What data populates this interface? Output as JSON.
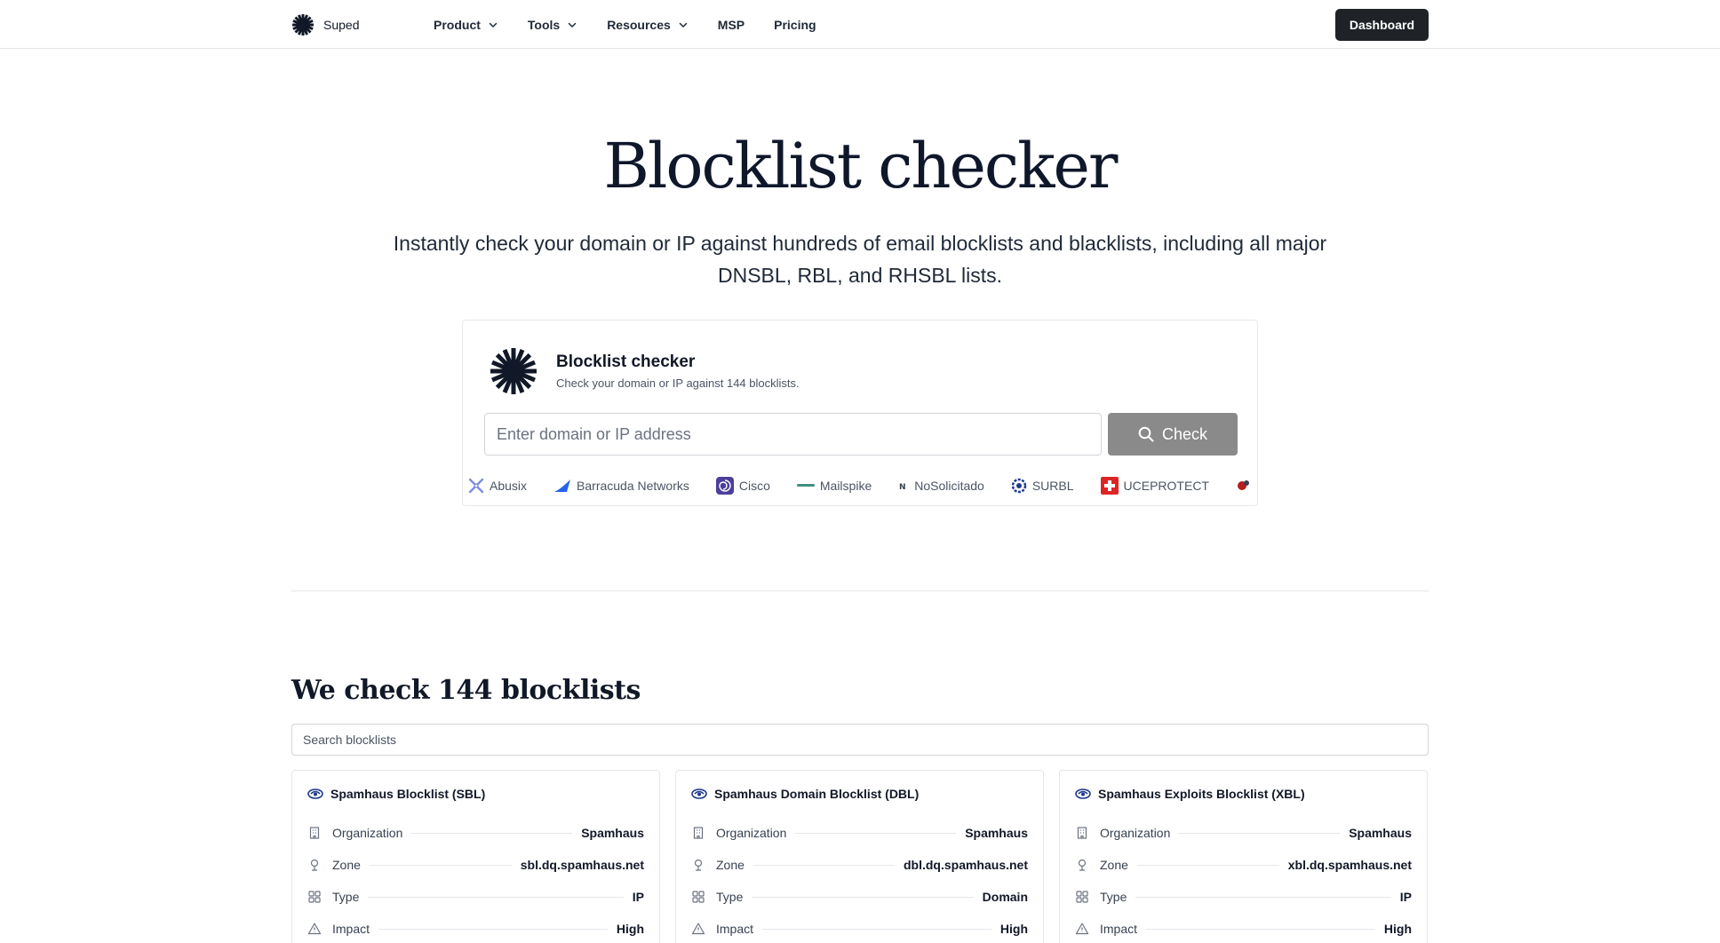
{
  "nav": {
    "brand": "Suped",
    "items": [
      {
        "label": "Product",
        "has_menu": true
      },
      {
        "label": "Tools",
        "has_menu": true
      },
      {
        "label": "Resources",
        "has_menu": true
      },
      {
        "label": "MSP",
        "has_menu": false
      },
      {
        "label": "Pricing",
        "has_menu": false
      }
    ],
    "dashboard_label": "Dashboard"
  },
  "hero": {
    "title": "Blocklist checker",
    "subtitle": "Instantly check your domain or IP against hundreds of email blocklists and blacklists, including all major DNSBL, RBL, and RHSBL lists."
  },
  "checker": {
    "title": "Blocklist checker",
    "subtitle": "Check your domain or IP against 144 blocklists.",
    "input_placeholder": "Enter domain or IP address",
    "button_label": "Check",
    "providers": [
      {
        "name": "Abusix",
        "icon": "abusix-logo-icon",
        "color": "#7c8ce0"
      },
      {
        "name": "Barracuda Networks",
        "icon": "barracuda-logo-icon",
        "color": "#2563eb"
      },
      {
        "name": "Cisco",
        "icon": "cisco-logo-icon",
        "color": "#4c3f99"
      },
      {
        "name": "Mailspike",
        "icon": "mailspike-logo-icon",
        "color": "#3f8f7f"
      },
      {
        "name": "NoSolicitado",
        "icon": "nosolicitado-logo-icon",
        "color": "#374151"
      },
      {
        "name": "SURBL",
        "icon": "surbl-logo-icon",
        "color": "#1e3a8a"
      },
      {
        "name": "UCEPROTECT",
        "icon": "uceprotect-logo-icon",
        "color": "#dc2626"
      }
    ]
  },
  "blocklists": {
    "title": "We check 144 blocklists",
    "search_placeholder": "Search blocklists",
    "cards": [
      {
        "name": "Spamhaus Blocklist (SBL)",
        "rows": [
          {
            "key": "Organization",
            "value": "Spamhaus",
            "icon": "building-icon"
          },
          {
            "key": "Zone",
            "value": "sbl.dq.spamhaus.net",
            "icon": "location-pin-icon"
          },
          {
            "key": "Type",
            "value": "IP",
            "icon": "grid-icon"
          },
          {
            "key": "Impact",
            "value": "High",
            "icon": "warning-icon"
          }
        ]
      },
      {
        "name": "Spamhaus Domain Blocklist (DBL)",
        "rows": [
          {
            "key": "Organization",
            "value": "Spamhaus",
            "icon": "building-icon"
          },
          {
            "key": "Zone",
            "value": "dbl.dq.spamhaus.net",
            "icon": "location-pin-icon"
          },
          {
            "key": "Type",
            "value": "Domain",
            "icon": "grid-icon"
          },
          {
            "key": "Impact",
            "value": "High",
            "icon": "warning-icon"
          }
        ]
      },
      {
        "name": "Spamhaus Exploits Blocklist (XBL)",
        "rows": [
          {
            "key": "Organization",
            "value": "Spamhaus",
            "icon": "building-icon"
          },
          {
            "key": "Zone",
            "value": "xbl.dq.spamhaus.net",
            "icon": "location-pin-icon"
          },
          {
            "key": "Type",
            "value": "IP",
            "icon": "grid-icon"
          },
          {
            "key": "Impact",
            "value": "High",
            "icon": "warning-icon"
          }
        ]
      }
    ]
  }
}
